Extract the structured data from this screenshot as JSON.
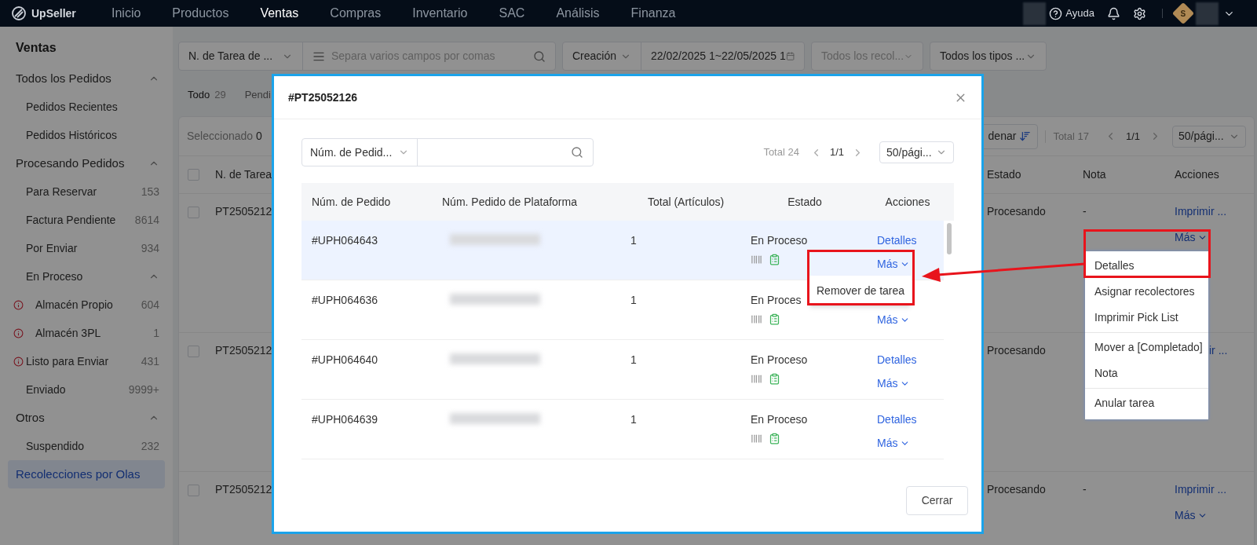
{
  "nav": {
    "logo": "UpSeller",
    "items": [
      {
        "label": "Inicio",
        "selected": false
      },
      {
        "label": "Productos",
        "selected": false
      },
      {
        "label": "Ventas",
        "selected": true
      },
      {
        "label": "Compras",
        "selected": false
      },
      {
        "label": "Inventario",
        "selected": false
      },
      {
        "label": "SAC",
        "selected": false
      },
      {
        "label": "Análisis",
        "selected": false
      },
      {
        "label": "Finanza",
        "selected": false
      }
    ],
    "help": "Ayuda",
    "avatar": "S"
  },
  "sidebar": {
    "title": "Ventas",
    "items": [
      {
        "label": "Todos los Pedidos",
        "selected": false,
        "expanded": true,
        "children": [
          {
            "label": "Pedidos Recientes",
            "selected": false,
            "warning": false
          },
          {
            "label": "Pedidos Históricos",
            "selected": false,
            "warning": false
          }
        ]
      },
      {
        "label": "Procesando Pedidos",
        "selected": false,
        "expanded": true,
        "children": [
          {
            "label": "Para Reservar",
            "count": "153",
            "selected": false,
            "warning": false
          },
          {
            "label": "Factura Pendiente",
            "count": "8614",
            "selected": false,
            "warning": false
          },
          {
            "label": "Por Enviar",
            "count": "934",
            "selected": false,
            "warning": false
          },
          {
            "label": "En Proceso",
            "selected": false,
            "warning": false,
            "expanded": true,
            "children": [
              {
                "label": "Almacén Propio",
                "count": "604",
                "selected": false,
                "warning": true
              },
              {
                "label": "Almacén 3PL",
                "count": "1",
                "selected": false,
                "warning": true
              }
            ]
          },
          {
            "label": "Listo para Enviar",
            "count": "431",
            "selected": false,
            "warning": true
          },
          {
            "label": "Enviado",
            "count": "9999+",
            "selected": false,
            "warning": false
          }
        ]
      },
      {
        "label": "Otros",
        "selected": false,
        "expanded": true,
        "children": [
          {
            "label": "Suspendido",
            "count": "232",
            "selected": false,
            "warning": false
          }
        ]
      },
      {
        "label": "Recolecciones por Olas",
        "selected": true
      }
    ]
  },
  "filter_groups": [
    [
      {
        "kind": "select",
        "value": "N. de Tarea de ..."
      },
      {
        "kind": "search",
        "placeholder": "Separa varios campos por comas"
      }
    ],
    [
      {
        "kind": "select",
        "value": "Creación"
      },
      {
        "kind": "date",
        "value": "22/02/2025 1~22/05/2025 1"
      }
    ],
    [
      {
        "kind": "select",
        "placeholder": "Todos los recol..."
      }
    ],
    [
      {
        "kind": "select",
        "value": "Todos los tipos ..."
      }
    ]
  ],
  "tabs": [
    {
      "label": "Todo",
      "count": "29",
      "selected": true
    },
    {
      "label": "Pendi",
      "selected": false
    }
  ],
  "table": {
    "toolbar": {
      "selected_label": "Seleccionado",
      "selected_count": "0",
      "sort_label": "denar",
      "total": "Total 17",
      "page": "1/1",
      "page_size": "50/pági..."
    },
    "header_checked": false,
    "columns": [
      "N. de Tarea",
      "Estado",
      "Nota",
      "Acciones"
    ],
    "rows": [
      {
        "task": "PT2505212",
        "status": "Procesando",
        "note": "-",
        "action": "Imprimir ...",
        "more": "Más",
        "checked": false
      },
      {
        "task": "PT2505212",
        "status": "Procesando",
        "action": "ir ...",
        "checked": false
      },
      {
        "task": "PT2505212",
        "status": "Procesando",
        "note": "-",
        "action": "Imprimir ...",
        "more": "Más",
        "checked": false
      }
    ],
    "menu": [
      [
        "Detalles",
        "Asignar recolectores",
        "Imprimir Pick List"
      ],
      [
        "Mover a [Completado]",
        "Nota"
      ],
      [
        "Anular tarea"
      ]
    ]
  },
  "modal": {
    "title": "#PT25052126",
    "search_field": "Núm. de Pedid...",
    "total": "Total 24",
    "page": "1/1",
    "page_size": "50/pági...",
    "columns": [
      "Núm. de Pedido",
      "Núm. Pedido de Plataforma",
      "Total (Artículos)",
      "Estado",
      "Acciones"
    ],
    "rows": [
      {
        "order": "#UPH064643",
        "total": "1",
        "status": "En Proceso",
        "details": "Detalles",
        "more": "Más",
        "selected": true,
        "menu": [
          "Remover de tarea"
        ]
      },
      {
        "order": "#UPH064636",
        "total": "1",
        "status": "En Proces",
        "more": "Más",
        "selected": false
      },
      {
        "order": "#UPH064640",
        "total": "1",
        "status": "En Proceso",
        "details": "Detalles",
        "more": "Más",
        "selected": false
      },
      {
        "order": "#UPH064639",
        "total": "1",
        "status": "En Proceso",
        "details": "Detalles",
        "more": "Más",
        "selected": false
      }
    ],
    "close_button": "Cerrar"
  }
}
